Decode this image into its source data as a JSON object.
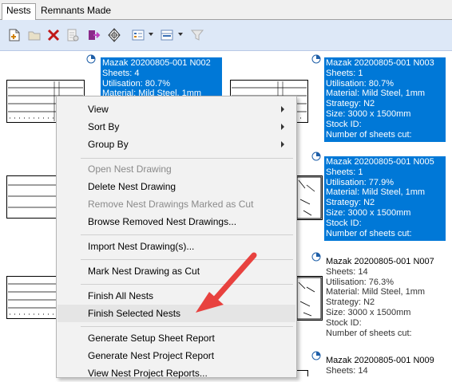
{
  "tabs": [
    {
      "label": "Nests"
    },
    {
      "label": "Remnants Made"
    }
  ],
  "toolbar": {
    "icons": [
      "new-nest-icon",
      "open-folder-icon",
      "delete-x-icon",
      "properties-icon",
      "export-icon",
      "nest-settings-icon",
      "view-mode-icon",
      "group-mode-icon",
      "filter-icon"
    ]
  },
  "nests": [
    {
      "title": "Mazak 20200805-001 N002",
      "sheets": "Sheets: 4",
      "utilisation": "Utilisation: 80.7%",
      "material": "Material: Mild Steel, 1mm",
      "selected": true
    },
    {
      "title": "Mazak 20200805-001 N003",
      "sheets": "Sheets: 1",
      "utilisation": "Utilisation: 80.7%",
      "material": "Material: Mild Steel, 1mm",
      "strategy": "Strategy: N2",
      "size": "Size: 3000 x 1500mm",
      "stock": "Stock ID:",
      "cut": "Number of sheets cut:",
      "selected": true
    },
    {
      "title": "Mazak 20200805-001 N005",
      "sheets": "Sheets: 1",
      "utilisation": "Utilisation: 77.9%",
      "material": "Material: Mild Steel, 1mm",
      "strategy": "Strategy: N2",
      "size": "Size: 3000 x 1500mm",
      "stock": "Stock ID:",
      "cut": "Number of sheets cut:",
      "selected": true
    },
    {
      "title": "Mazak 20200805-001 N007",
      "sheets": "Sheets: 14",
      "utilisation": "Utilisation: 76.3%",
      "material": "Material: Mild Steel, 1mm",
      "strategy": "Strategy: N2",
      "size": "Size: 3000 x 1500mm",
      "stock": "Stock ID:",
      "cut": "Number of sheets cut:",
      "selected": false
    },
    {
      "title": "Mazak 20200805-001 N009",
      "sheets": "Sheets: 14",
      "selected": false
    }
  ],
  "context_menu": {
    "view": "View",
    "sort_by": "Sort By",
    "group_by": "Group By",
    "open_nest_drawing": "Open Nest Drawing",
    "delete_nest_drawing": "Delete Nest Drawing",
    "remove_marked_as_cut": "Remove Nest Drawings Marked as Cut",
    "browse_removed": "Browse Removed Nest Drawings...",
    "import_nest_drawing": "Import Nest Drawing(s)...",
    "mark_as_cut": "Mark Nest Drawing as Cut",
    "finish_all": "Finish All Nests",
    "finish_selected": "Finish Selected Nests",
    "setup_sheet_report": "Generate Setup Sheet Report",
    "nest_project_report": "Generate Nest Project Report",
    "view_project_reports": "View Nest Project Reports..."
  },
  "colors": {
    "selection": "#0078d7",
    "toolbar_bg": "#dde8f7",
    "menu_bg": "#f2f2f2",
    "annotation_arrow": "#e8423f"
  }
}
